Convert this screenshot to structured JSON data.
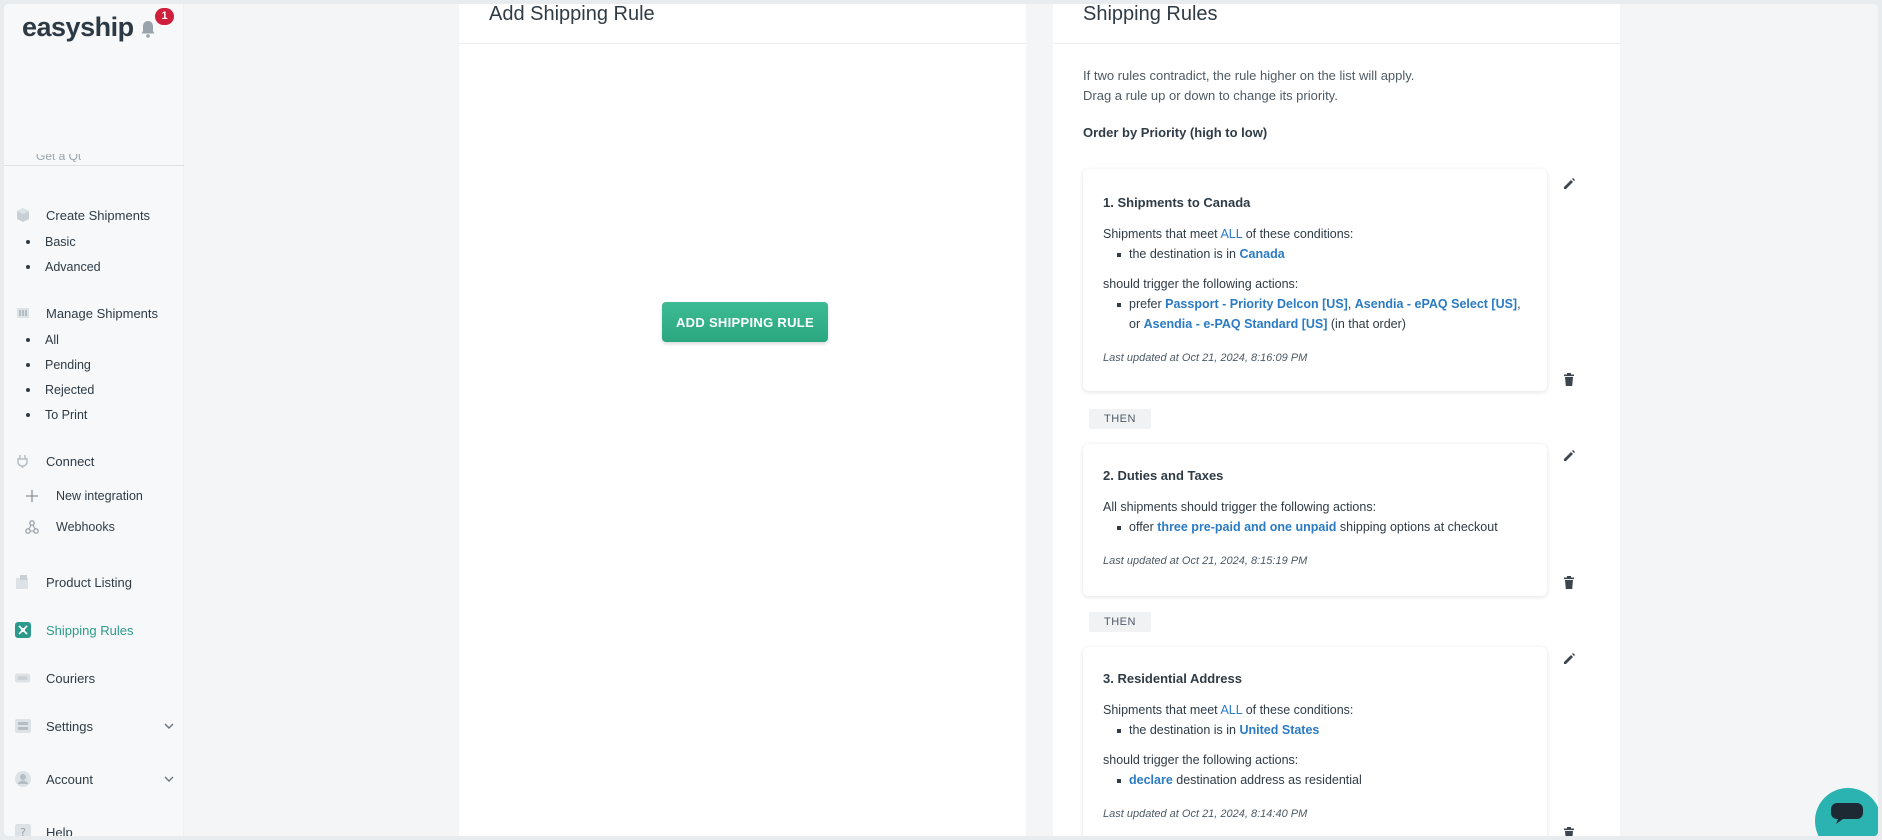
{
  "brand": {
    "name": "easyship",
    "notifications": "1"
  },
  "sidebar": {
    "clipped_item": "Get a Quote",
    "create_shipments": {
      "label": "Create Shipments",
      "children": [
        "Basic",
        "Advanced"
      ]
    },
    "manage_shipments": {
      "label": "Manage Shipments",
      "children": [
        "All",
        "Pending",
        "Rejected",
        "To Print"
      ]
    },
    "connect": {
      "label": "Connect",
      "children": [
        "New integration",
        "Webhooks"
      ]
    },
    "product_listing": "Product Listing",
    "shipping_rules": "Shipping Rules",
    "couriers": "Couriers",
    "settings": "Settings",
    "account": "Account",
    "help": "Help"
  },
  "add_panel": {
    "title": "Add Shipping Rule",
    "button": "ADD SHIPPING RULE"
  },
  "rules_panel": {
    "title": "Shipping Rules",
    "intro_line1": "If two rules contradict, the rule higher on the list will apply.",
    "intro_line2": "Drag a rule up or down to change its priority.",
    "order_label": "Order by Priority (high to low)",
    "then_label": "THEN",
    "rules": [
      {
        "title": "1. Shipments to Canada",
        "cond_prefix": "Shipments that meet ",
        "cond_all": "ALL",
        "cond_suffix": " of these conditions:",
        "cond_text": "the destination is in ",
        "cond_value": "Canada",
        "action_intro": "should trigger the following actions:",
        "action_prefix": "prefer ",
        "courier1": "Passport - Priority Delcon [US]",
        "sep1": ", ",
        "courier2": "Asendia - ePAQ Select [US]",
        "sep2": ",",
        "or": "or ",
        "courier3": "Asendia - e-PAQ Standard [US]",
        "order_note": " (in that order)",
        "updated": "Last updated at Oct 21, 2024, 8:16:09 PM"
      },
      {
        "title": "2. Duties and Taxes",
        "action_intro": "All shipments should trigger the following actions:",
        "action_prefix": "offer ",
        "action_value": "three pre-paid and one unpaid",
        "action_suffix": " shipping options at checkout",
        "updated": "Last updated at Oct 21, 2024, 8:15:19 PM"
      },
      {
        "title": "3. Residential Address",
        "cond_prefix": "Shipments that meet ",
        "cond_all": "ALL",
        "cond_suffix": " of these conditions:",
        "cond_text": "the destination is in ",
        "cond_value": "United States",
        "action_intro": "should trigger the following actions:",
        "action_value": "declare",
        "action_suffix": " destination address as residential",
        "updated": "Last updated at Oct 21, 2024, 8:14:40 PM"
      }
    ]
  },
  "colors": {
    "accent": "#2c9a8b",
    "link": "#2a7bc4",
    "button": "#2aa77f",
    "badge": "#d01f3c",
    "chat": "#2bb3b1"
  }
}
